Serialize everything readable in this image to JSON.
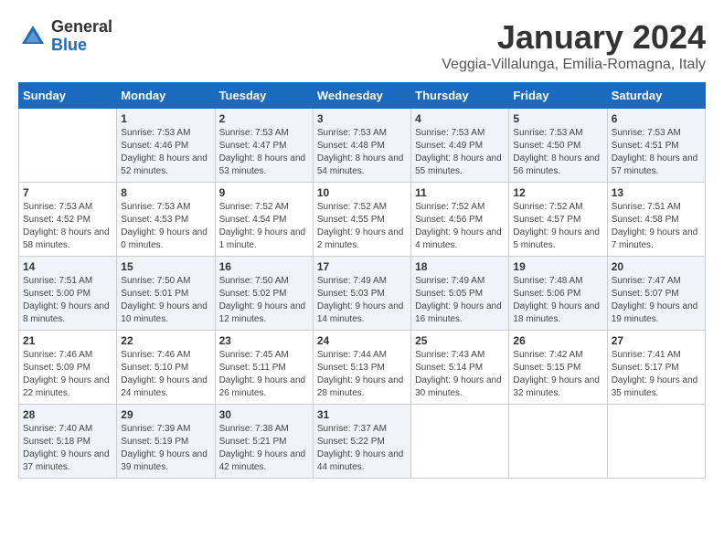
{
  "logo": {
    "general": "General",
    "blue": "Blue"
  },
  "title": "January 2024",
  "location": "Veggia-Villalunga, Emilia-Romagna, Italy",
  "headers": [
    "Sunday",
    "Monday",
    "Tuesday",
    "Wednesday",
    "Thursday",
    "Friday",
    "Saturday"
  ],
  "weeks": [
    [
      {
        "day": "",
        "sunrise": "",
        "sunset": "",
        "daylight": ""
      },
      {
        "day": "1",
        "sunrise": "Sunrise: 7:53 AM",
        "sunset": "Sunset: 4:46 PM",
        "daylight": "Daylight: 8 hours and 52 minutes."
      },
      {
        "day": "2",
        "sunrise": "Sunrise: 7:53 AM",
        "sunset": "Sunset: 4:47 PM",
        "daylight": "Daylight: 8 hours and 53 minutes."
      },
      {
        "day": "3",
        "sunrise": "Sunrise: 7:53 AM",
        "sunset": "Sunset: 4:48 PM",
        "daylight": "Daylight: 8 hours and 54 minutes."
      },
      {
        "day": "4",
        "sunrise": "Sunrise: 7:53 AM",
        "sunset": "Sunset: 4:49 PM",
        "daylight": "Daylight: 8 hours and 55 minutes."
      },
      {
        "day": "5",
        "sunrise": "Sunrise: 7:53 AM",
        "sunset": "Sunset: 4:50 PM",
        "daylight": "Daylight: 8 hours and 56 minutes."
      },
      {
        "day": "6",
        "sunrise": "Sunrise: 7:53 AM",
        "sunset": "Sunset: 4:51 PM",
        "daylight": "Daylight: 8 hours and 57 minutes."
      }
    ],
    [
      {
        "day": "7",
        "sunrise": "Sunrise: 7:53 AM",
        "sunset": "Sunset: 4:52 PM",
        "daylight": "Daylight: 8 hours and 58 minutes."
      },
      {
        "day": "8",
        "sunrise": "Sunrise: 7:53 AM",
        "sunset": "Sunset: 4:53 PM",
        "daylight": "Daylight: 9 hours and 0 minutes."
      },
      {
        "day": "9",
        "sunrise": "Sunrise: 7:52 AM",
        "sunset": "Sunset: 4:54 PM",
        "daylight": "Daylight: 9 hours and 1 minute."
      },
      {
        "day": "10",
        "sunrise": "Sunrise: 7:52 AM",
        "sunset": "Sunset: 4:55 PM",
        "daylight": "Daylight: 9 hours and 2 minutes."
      },
      {
        "day": "11",
        "sunrise": "Sunrise: 7:52 AM",
        "sunset": "Sunset: 4:56 PM",
        "daylight": "Daylight: 9 hours and 4 minutes."
      },
      {
        "day": "12",
        "sunrise": "Sunrise: 7:52 AM",
        "sunset": "Sunset: 4:57 PM",
        "daylight": "Daylight: 9 hours and 5 minutes."
      },
      {
        "day": "13",
        "sunrise": "Sunrise: 7:51 AM",
        "sunset": "Sunset: 4:58 PM",
        "daylight": "Daylight: 9 hours and 7 minutes."
      }
    ],
    [
      {
        "day": "14",
        "sunrise": "Sunrise: 7:51 AM",
        "sunset": "Sunset: 5:00 PM",
        "daylight": "Daylight: 9 hours and 8 minutes."
      },
      {
        "day": "15",
        "sunrise": "Sunrise: 7:50 AM",
        "sunset": "Sunset: 5:01 PM",
        "daylight": "Daylight: 9 hours and 10 minutes."
      },
      {
        "day": "16",
        "sunrise": "Sunrise: 7:50 AM",
        "sunset": "Sunset: 5:02 PM",
        "daylight": "Daylight: 9 hours and 12 minutes."
      },
      {
        "day": "17",
        "sunrise": "Sunrise: 7:49 AM",
        "sunset": "Sunset: 5:03 PM",
        "daylight": "Daylight: 9 hours and 14 minutes."
      },
      {
        "day": "18",
        "sunrise": "Sunrise: 7:49 AM",
        "sunset": "Sunset: 5:05 PM",
        "daylight": "Daylight: 9 hours and 16 minutes."
      },
      {
        "day": "19",
        "sunrise": "Sunrise: 7:48 AM",
        "sunset": "Sunset: 5:06 PM",
        "daylight": "Daylight: 9 hours and 18 minutes."
      },
      {
        "day": "20",
        "sunrise": "Sunrise: 7:47 AM",
        "sunset": "Sunset: 5:07 PM",
        "daylight": "Daylight: 9 hours and 19 minutes."
      }
    ],
    [
      {
        "day": "21",
        "sunrise": "Sunrise: 7:46 AM",
        "sunset": "Sunset: 5:09 PM",
        "daylight": "Daylight: 9 hours and 22 minutes."
      },
      {
        "day": "22",
        "sunrise": "Sunrise: 7:46 AM",
        "sunset": "Sunset: 5:10 PM",
        "daylight": "Daylight: 9 hours and 24 minutes."
      },
      {
        "day": "23",
        "sunrise": "Sunrise: 7:45 AM",
        "sunset": "Sunset: 5:11 PM",
        "daylight": "Daylight: 9 hours and 26 minutes."
      },
      {
        "day": "24",
        "sunrise": "Sunrise: 7:44 AM",
        "sunset": "Sunset: 5:13 PM",
        "daylight": "Daylight: 9 hours and 28 minutes."
      },
      {
        "day": "25",
        "sunrise": "Sunrise: 7:43 AM",
        "sunset": "Sunset: 5:14 PM",
        "daylight": "Daylight: 9 hours and 30 minutes."
      },
      {
        "day": "26",
        "sunrise": "Sunrise: 7:42 AM",
        "sunset": "Sunset: 5:15 PM",
        "daylight": "Daylight: 9 hours and 32 minutes."
      },
      {
        "day": "27",
        "sunrise": "Sunrise: 7:41 AM",
        "sunset": "Sunset: 5:17 PM",
        "daylight": "Daylight: 9 hours and 35 minutes."
      }
    ],
    [
      {
        "day": "28",
        "sunrise": "Sunrise: 7:40 AM",
        "sunset": "Sunset: 5:18 PM",
        "daylight": "Daylight: 9 hours and 37 minutes."
      },
      {
        "day": "29",
        "sunrise": "Sunrise: 7:39 AM",
        "sunset": "Sunset: 5:19 PM",
        "daylight": "Daylight: 9 hours and 39 minutes."
      },
      {
        "day": "30",
        "sunrise": "Sunrise: 7:38 AM",
        "sunset": "Sunset: 5:21 PM",
        "daylight": "Daylight: 9 hours and 42 minutes."
      },
      {
        "day": "31",
        "sunrise": "Sunrise: 7:37 AM",
        "sunset": "Sunset: 5:22 PM",
        "daylight": "Daylight: 9 hours and 44 minutes."
      },
      {
        "day": "",
        "sunrise": "",
        "sunset": "",
        "daylight": ""
      },
      {
        "day": "",
        "sunrise": "",
        "sunset": "",
        "daylight": ""
      },
      {
        "day": "",
        "sunrise": "",
        "sunset": "",
        "daylight": ""
      }
    ]
  ]
}
